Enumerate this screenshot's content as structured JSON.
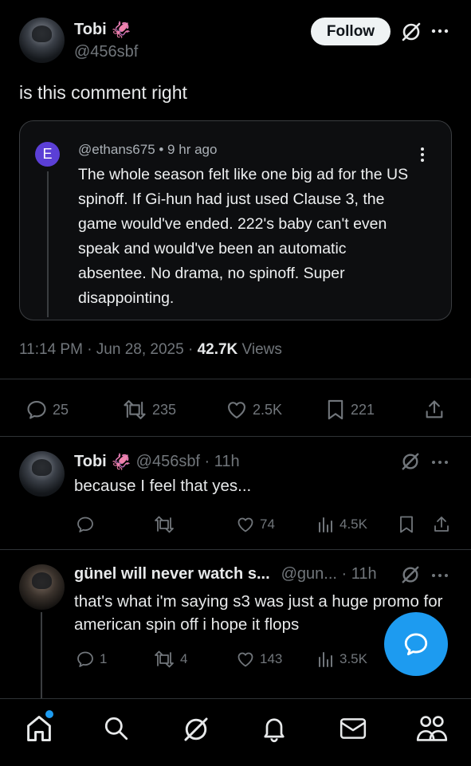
{
  "main_post": {
    "author_name": "Tobi",
    "author_emoji": "🦑",
    "handle": "@456sbf",
    "follow_label": "Follow",
    "text": "is this comment right",
    "quoted_comment": {
      "avatar_letter": "E",
      "meta": "@ethans675 • 9 hr ago",
      "body": "The whole season felt like one big ad for the US spinoff. If Gi-hun had just used Clause 3, the game would've ended. 222's baby can't even speak and would've been an automatic absentee. No drama, no spinoff. Super disappointing."
    },
    "timestamp": "11:14 PM · Jun 28, 2025 · ",
    "views_count": "42.7K",
    "views_label": " Views",
    "stats": {
      "replies": "25",
      "reposts": "235",
      "likes": "2.5K",
      "bookmarks": "221"
    }
  },
  "replies": [
    {
      "author_name": "Tobi",
      "handle_time": "@456sbf · 11h",
      "text": "because I feel that yes...",
      "stats": {
        "replies": "",
        "reposts": "",
        "likes": "74",
        "views": "4.5K"
      }
    },
    {
      "author_name": "günel will never watch s...",
      "handle_time": "@gun... · 11h",
      "text": "that's what i'm saying s3 was just a huge promo for american spin off i hope it flops",
      "stats": {
        "replies": "1",
        "reposts": "4",
        "likes": "143",
        "views": "3.5K"
      }
    }
  ],
  "colors": {
    "accent": "#1d9bf0",
    "background": "#000000",
    "muted": "#71767b",
    "avatar_e": "#5b3fd6"
  },
  "bottom_nav": [
    "home-icon",
    "search-icon",
    "grok-icon",
    "notifications-icon",
    "messages-icon",
    "communities-icon"
  ]
}
